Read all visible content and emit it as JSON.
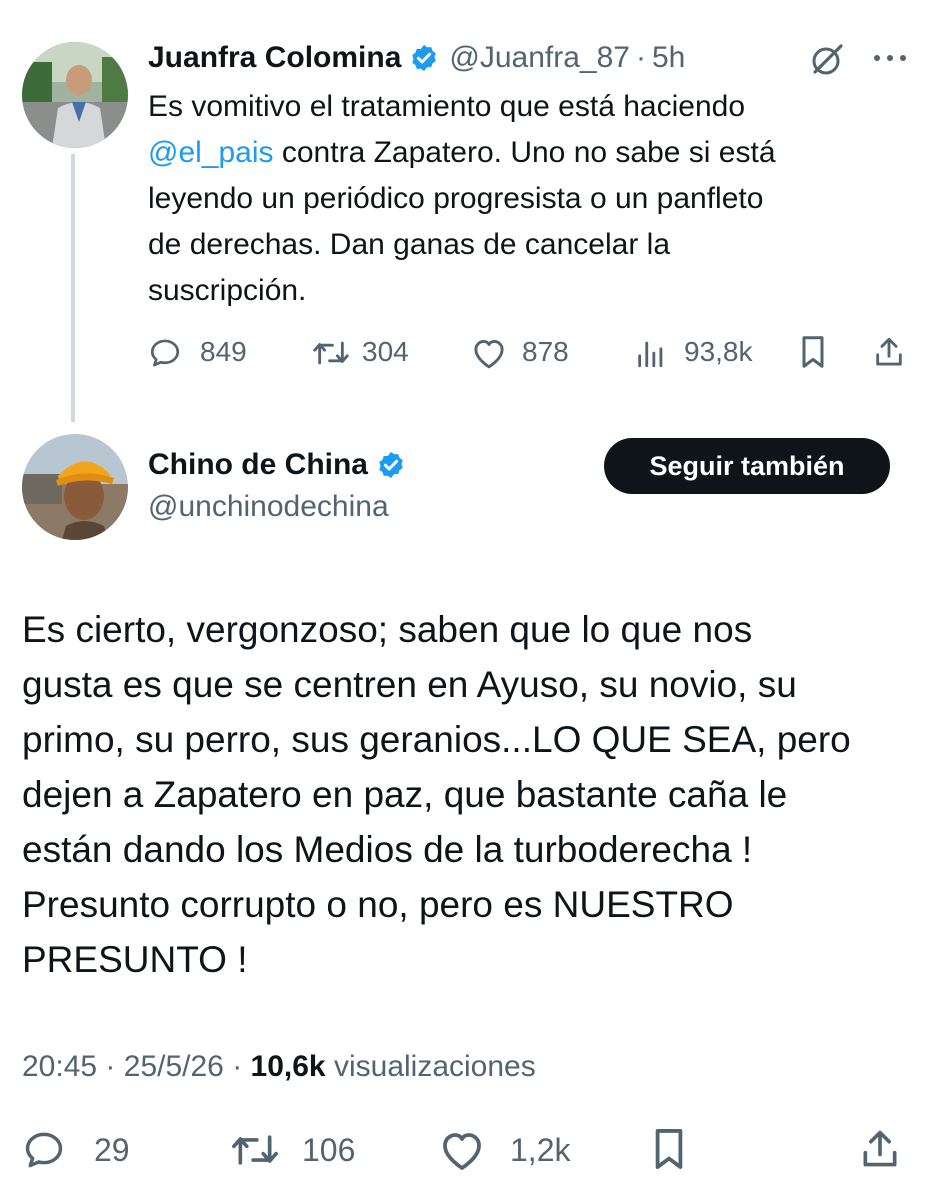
{
  "parent_tweet": {
    "author_name": "Juanfra Colomina",
    "author_handle": "@Juanfra_87",
    "separator": "·",
    "time": "5h",
    "text_lines": [
      "Es vomitivo el tratamiento que está haciendo",
      "contra Zapatero. Uno no sabe si está",
      "leyendo un periódico progresista o un panfleto",
      "de derechas. Dan ganas de cancelar la",
      "suscripción."
    ],
    "mention": "@el_pais",
    "replies": "849",
    "retweets": "304",
    "likes": "878",
    "views": "93,8k"
  },
  "reply_tweet": {
    "author_name": "Chino de China",
    "author_handle": "@unchinodechina",
    "follow_label": "Seguir también",
    "text_lines": [
      "Es cierto, vergonzoso; saben que lo que nos",
      "gusta es que se centren en Ayuso, su novio, su",
      "primo, su perro, sus geranios...LO QUE SEA, pero",
      "dejen a Zapatero en paz, que bastante caña le",
      "están dando los Medios de la turboderecha !",
      "Presunto corrupto o no, pero es NUESTRO",
      "PRESUNTO !"
    ],
    "time": "20:45",
    "date": "25/5/26",
    "separator": "·",
    "views_count": "10,6k",
    "views_label": "visualizaciones",
    "replies": "29",
    "retweets": "106",
    "likes": "1,2k"
  },
  "icons": {
    "verified": "verified-badge-icon",
    "grok": "grok-icon",
    "more": "more-icon",
    "reply": "reply-icon",
    "retweet": "retweet-icon",
    "like": "like-icon",
    "views": "views-icon",
    "bookmark": "bookmark-icon",
    "share": "share-icon"
  },
  "colors": {
    "text": "#0f1419",
    "secondary": "#536471",
    "link": "#1d9bf0",
    "verified": "#1d9bf0",
    "button": "#0f1419"
  }
}
